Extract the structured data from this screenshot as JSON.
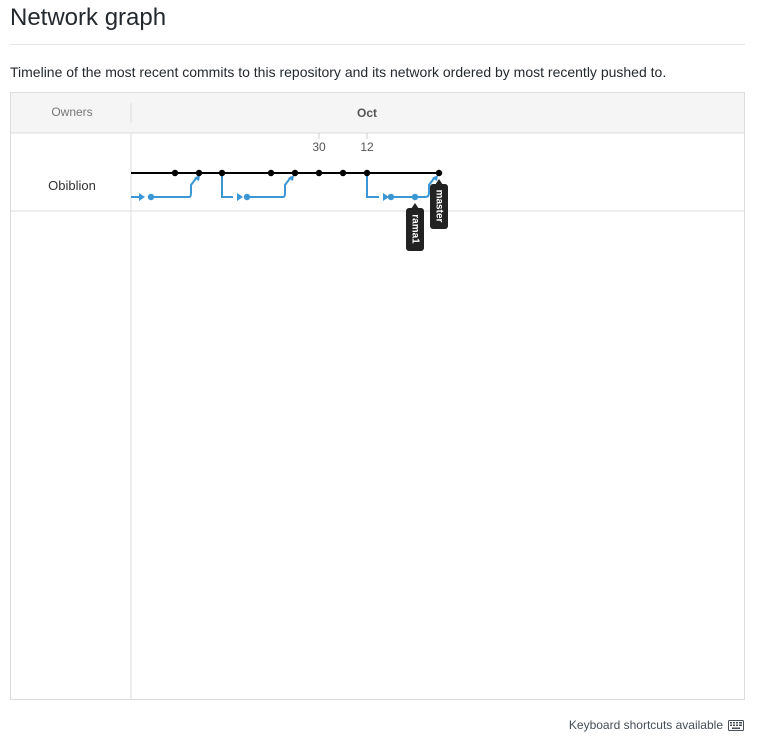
{
  "page": {
    "title": "Network graph",
    "description": "Timeline of the most recent commits to this repository and its network ordered by most recently pushed to."
  },
  "graph": {
    "owners_header": "Owners",
    "month_label": "Oct",
    "day_labels": [
      "30",
      "12"
    ],
    "owners": [
      "Obiblion"
    ],
    "branch_labels": [
      "master",
      "rama1"
    ],
    "colors": {
      "master_line": "#000000",
      "branch_line": "#3a97d4",
      "header_bg": "#f5f5f5",
      "grid": "#dcdcdc",
      "label_bg": "#222222"
    }
  },
  "footer": {
    "shortcuts_text": "Keyboard shortcuts available",
    "icon": "keyboard-icon"
  }
}
